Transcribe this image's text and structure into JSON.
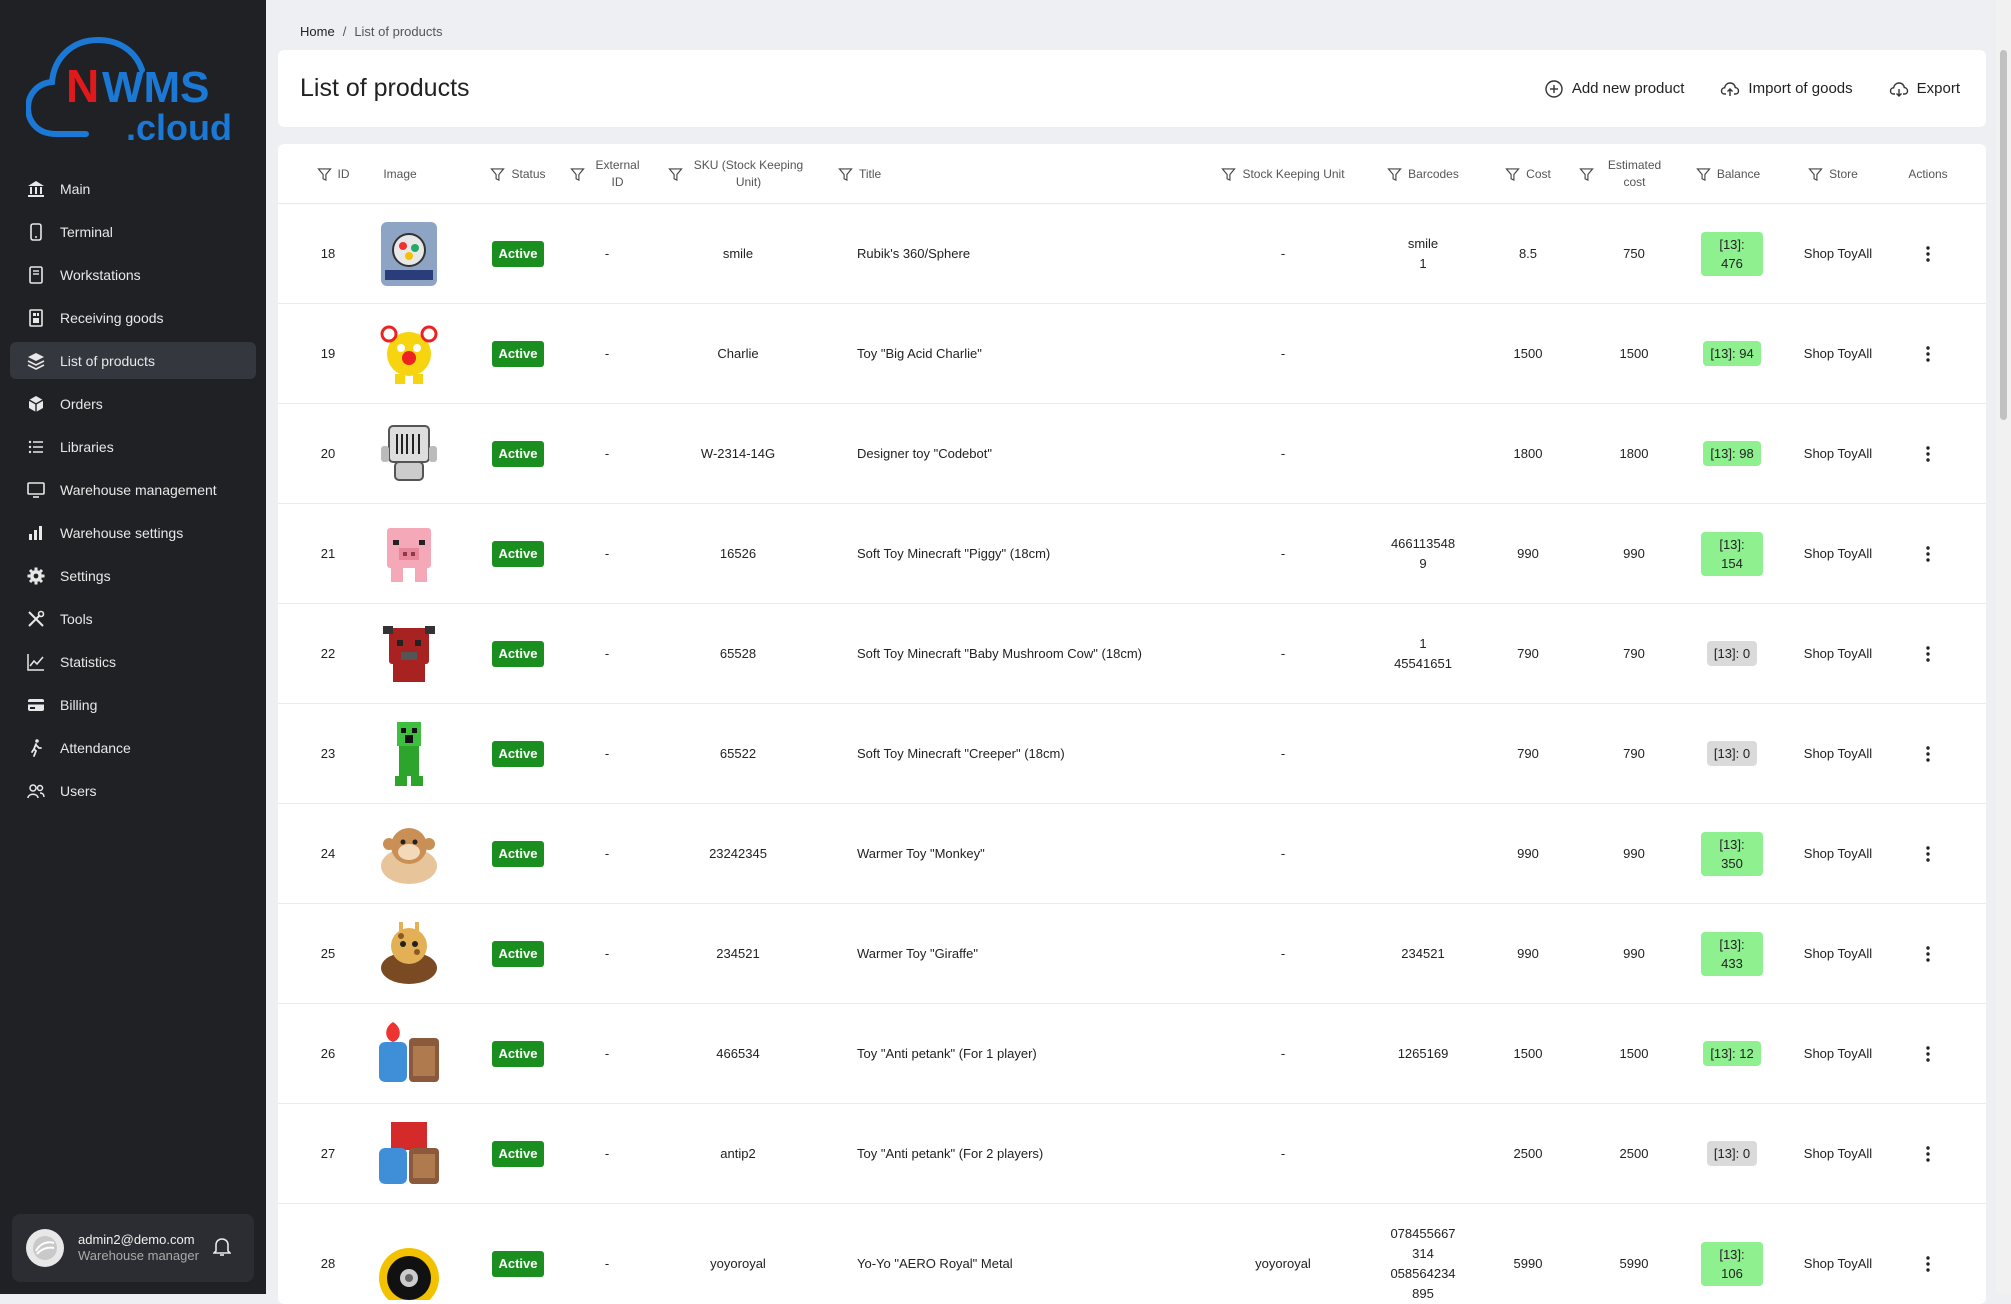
{
  "brand": {
    "logo_n": "N",
    "logo_wms": "WMS",
    "logo_cloud": ".cloud"
  },
  "sidebar": {
    "items": [
      {
        "label": "Main",
        "icon": "bank-icon"
      },
      {
        "label": "Terminal",
        "icon": "tablet-icon"
      },
      {
        "label": "Workstations",
        "icon": "workstation-icon"
      },
      {
        "label": "Receiving goods",
        "icon": "receiving-icon"
      },
      {
        "label": "List of products",
        "icon": "layers-icon",
        "active": true
      },
      {
        "label": "Orders",
        "icon": "box-icon"
      },
      {
        "label": "Libraries",
        "icon": "list-icon"
      },
      {
        "label": "Warehouse management",
        "icon": "monitor-icon"
      },
      {
        "label": "Warehouse settings",
        "icon": "bars-icon"
      },
      {
        "label": "Settings",
        "icon": "gear-icon"
      },
      {
        "label": "Tools",
        "icon": "tools-icon"
      },
      {
        "label": "Statistics",
        "icon": "chart-icon"
      },
      {
        "label": "Billing",
        "icon": "card-icon"
      },
      {
        "label": "Attendance",
        "icon": "walk-icon"
      },
      {
        "label": "Users",
        "icon": "users-icon"
      }
    ],
    "user": {
      "email": "admin2@demo.com",
      "role": "Warehouse manager"
    }
  },
  "breadcrumb": {
    "home": "Home",
    "sep": "/",
    "current": "List of products"
  },
  "header": {
    "title": "List of products",
    "add_label": "Add new product",
    "import_label": "Import of goods",
    "export_label": "Export"
  },
  "table": {
    "columns": {
      "id": "ID",
      "image": "Image",
      "status": "Status",
      "external_id": "External ID",
      "sku": "SKU (Stock Keeping Unit)",
      "title": "Title",
      "stock_unit": "Stock Keeping Unit",
      "barcodes": "Barcodes",
      "cost": "Cost",
      "estimated_cost": "Estimated cost",
      "balance": "Balance",
      "store": "Store",
      "actions": "Actions"
    },
    "rows": [
      {
        "id": "18",
        "status": "Active",
        "external_id": "-",
        "sku": "smile",
        "title": "Rubik's 360/Sphere",
        "stock_unit": "-",
        "barcodes": "smile\n1",
        "cost": "8.5",
        "estimated_cost": "750",
        "balance": "[13]: 476",
        "balance_state": "green",
        "store": "Shop ToyAll"
      },
      {
        "id": "19",
        "status": "Active",
        "external_id": "-",
        "sku": "Charlie",
        "title": "Toy \"Big Acid Charlie\"",
        "stock_unit": "-",
        "barcodes": "",
        "cost": "1500",
        "estimated_cost": "1500",
        "balance": "[13]: 94",
        "balance_state": "green",
        "store": "Shop ToyAll"
      },
      {
        "id": "20",
        "status": "Active",
        "external_id": "-",
        "sku": "W-2314-14G",
        "title": "Designer toy \"Codebot\"",
        "stock_unit": "-",
        "barcodes": "",
        "cost": "1800",
        "estimated_cost": "1800",
        "balance": "[13]: 98",
        "balance_state": "green",
        "store": "Shop ToyAll"
      },
      {
        "id": "21",
        "status": "Active",
        "external_id": "-",
        "sku": "16526",
        "title": "Soft Toy Minecraft \"Piggy\" (18cm)",
        "stock_unit": "-",
        "barcodes": "466113548\n9",
        "cost": "990",
        "estimated_cost": "990",
        "balance": "[13]: 154",
        "balance_state": "green",
        "store": "Shop ToyAll"
      },
      {
        "id": "22",
        "status": "Active",
        "external_id": "-",
        "sku": "65528",
        "title": "Soft Toy Minecraft \"Baby Mushroom Cow\" (18cm)",
        "stock_unit": "-",
        "barcodes": "1\n45541651",
        "cost": "790",
        "estimated_cost": "790",
        "balance": "[13]: 0",
        "balance_state": "grey",
        "store": "Shop ToyAll"
      },
      {
        "id": "23",
        "status": "Active",
        "external_id": "-",
        "sku": "65522",
        "title": "Soft Toy Minecraft \"Creeper\" (18cm)",
        "stock_unit": "-",
        "barcodes": "",
        "cost": "790",
        "estimated_cost": "790",
        "balance": "[13]: 0",
        "balance_state": "grey",
        "store": "Shop ToyAll"
      },
      {
        "id": "24",
        "status": "Active",
        "external_id": "-",
        "sku": "23242345",
        "title": "Warmer Toy \"Monkey\"",
        "stock_unit": "-",
        "barcodes": "",
        "cost": "990",
        "estimated_cost": "990",
        "balance": "[13]: 350",
        "balance_state": "green",
        "store": "Shop ToyAll"
      },
      {
        "id": "25",
        "status": "Active",
        "external_id": "-",
        "sku": "234521",
        "title": "Warmer Toy \"Giraffe\"",
        "stock_unit": "-",
        "barcodes": "234521",
        "cost": "990",
        "estimated_cost": "990",
        "balance": "[13]: 433",
        "balance_state": "green",
        "store": "Shop ToyAll"
      },
      {
        "id": "26",
        "status": "Active",
        "external_id": "-",
        "sku": "466534",
        "title": "Toy \"Anti petank\" (For 1 player)",
        "stock_unit": "-",
        "barcodes": "1265169",
        "cost": "1500",
        "estimated_cost": "1500",
        "balance": "[13]: 12",
        "balance_state": "green",
        "store": "Shop ToyAll"
      },
      {
        "id": "27",
        "status": "Active",
        "external_id": "-",
        "sku": "antip2",
        "title": "Toy \"Anti petank\" (For 2 players)",
        "stock_unit": "-",
        "barcodes": "",
        "cost": "2500",
        "estimated_cost": "2500",
        "balance": "[13]: 0",
        "balance_state": "grey",
        "store": "Shop ToyAll"
      },
      {
        "id": "28",
        "status": "Active",
        "external_id": "-",
        "sku": "yoyoroyal",
        "title": "Yo-Yo \"AERO Royal\" Metal",
        "stock_unit": "yoyoroyal",
        "barcodes": "078455667\n314\n058564234\n895",
        "cost": "5990",
        "estimated_cost": "5990",
        "balance": "[13]: 106",
        "balance_state": "green",
        "store": "Shop ToyAll"
      }
    ]
  },
  "colors": {
    "active_green": "#1a8f1f",
    "balance_green": "#8ef08f",
    "balance_grey": "#dadada",
    "logo_red": "#e0191c",
    "logo_blue": "#1b78d4",
    "sidebar_bg": "#1f2125"
  }
}
